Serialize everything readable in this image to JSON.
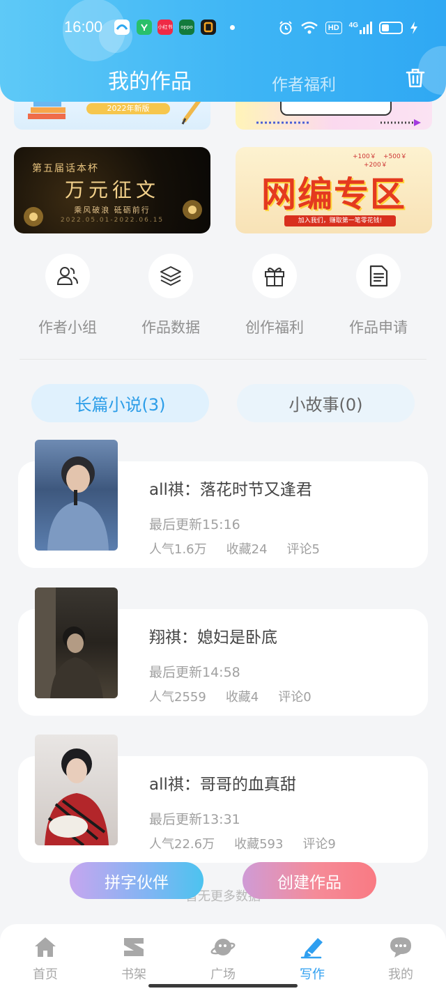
{
  "status_bar": {
    "time": "16:00",
    "app_icons": [
      "tv-app-icon",
      "ai-app-icon",
      "xhs-app-icon",
      "oppo-app-icon",
      "notes-app-icon"
    ],
    "xhs_text": "小红书",
    "oppo_text": "oppo",
    "hd_label": "HD",
    "signal_label": "4G"
  },
  "header": {
    "tab_mine": "我的作品",
    "tab_benefit": "作者福利"
  },
  "banners": {
    "top_left_pill": "2022年新版",
    "contest_top": "第五届话本杯",
    "contest_title": "万元征文",
    "contest_sub": "乘风破浪 砥砺前行",
    "contest_date": "2022.05.01-2022.06.15",
    "web_amounts": [
      "+100￥",
      "+500￥",
      "+200￥"
    ],
    "web_title": "网编专区",
    "web_strip": "加入我们，赚取第一笔零花钱!"
  },
  "shortcuts": [
    {
      "label": "作者小组",
      "icon": "users-icon"
    },
    {
      "label": "作品数据",
      "icon": "layers-icon"
    },
    {
      "label": "创作福利",
      "icon": "gift-icon"
    },
    {
      "label": "作品申请",
      "icon": "document-icon"
    }
  ],
  "category_tabs": {
    "long": "长篇小说(3)",
    "short": "小故事(0)"
  },
  "works": [
    {
      "title": "all祺：落花时节又逢君",
      "updated": "最后更新15:16",
      "popularity": "人气1.6万",
      "favorites": "收藏24",
      "comments": "评论5"
    },
    {
      "title": "翔祺：媳妇是卧底",
      "updated": "最后更新14:58",
      "popularity": "人气2559",
      "favorites": "收藏4",
      "comments": "评论0"
    },
    {
      "title": "all祺：哥哥的血真甜",
      "updated": "最后更新13:31",
      "popularity": "人气22.6万",
      "favorites": "收藏593",
      "comments": "评论9"
    }
  ],
  "no_more": "暂无更多数据",
  "fab": {
    "partner": "拼字伙伴",
    "create": "创建作品"
  },
  "bottom_nav": [
    {
      "label": "首页",
      "icon": "home-icon"
    },
    {
      "label": "书架",
      "icon": "bookshelf-icon"
    },
    {
      "label": "广场",
      "icon": "planet-icon"
    },
    {
      "label": "写作",
      "icon": "pen-icon",
      "active": true
    },
    {
      "label": "我的",
      "icon": "chat-bubble-icon"
    }
  ],
  "colors": {
    "header": "#3eb5f5",
    "accent": "#2f9ff0",
    "create_button": "#f58b98"
  }
}
